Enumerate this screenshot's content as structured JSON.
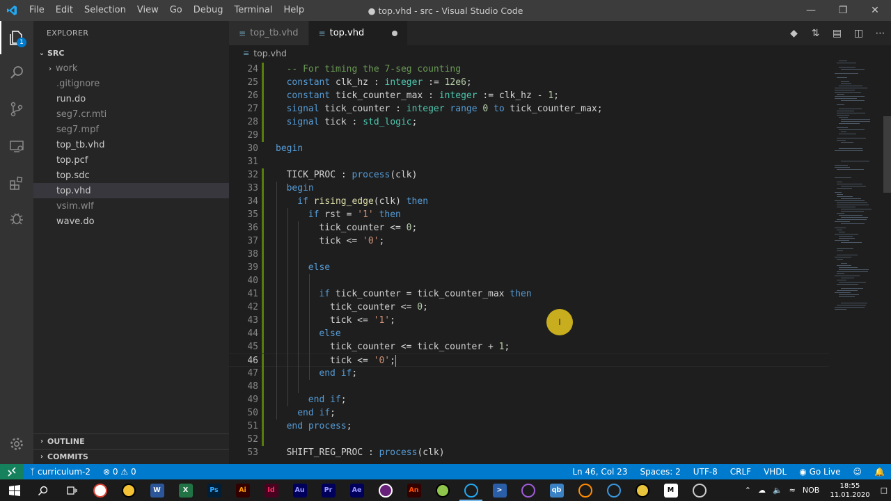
{
  "window": {
    "title": "● top.vhd - src - Visual Studio Code",
    "menu": [
      "File",
      "Edit",
      "Selection",
      "View",
      "Go",
      "Debug",
      "Terminal",
      "Help"
    ]
  },
  "activity_bar": {
    "explorer_badge": "1"
  },
  "sidebar": {
    "title": "EXPLORER",
    "folder": "SRC",
    "items": [
      {
        "label": "work",
        "folder": true,
        "dim": true
      },
      {
        "label": ".gitignore",
        "dim": true
      },
      {
        "label": "run.do"
      },
      {
        "label": "seg7.cr.mti",
        "dim": true
      },
      {
        "label": "seg7.mpf",
        "dim": true
      },
      {
        "label": "top_tb.vhd"
      },
      {
        "label": "top.pcf"
      },
      {
        "label": "top.sdc"
      },
      {
        "label": "top.vhd",
        "selected": true
      },
      {
        "label": "vsim.wlf",
        "dim": true
      },
      {
        "label": "wave.do"
      }
    ],
    "outline": "OUTLINE",
    "commits": "COMMITS"
  },
  "tabs": [
    {
      "label": "top_tb.vhd",
      "active": false
    },
    {
      "label": "top.vhd",
      "active": true,
      "dirty": true
    }
  ],
  "breadcrumb": "top.vhd",
  "editor": {
    "lines": [
      {
        "n": "24",
        "indent": 1,
        "tokens": [
          [
            "cm",
            "-- For timing the 7-seg counting"
          ]
        ]
      },
      {
        "n": "25",
        "indent": 1,
        "tokens": [
          [
            "kw",
            "constant"
          ],
          [
            "id",
            " clk_hz : "
          ],
          [
            "ty",
            "integer"
          ],
          [
            "id",
            " := "
          ],
          [
            "num",
            "12e6"
          ],
          [
            "id",
            ";"
          ]
        ]
      },
      {
        "n": "26",
        "indent": 1,
        "tokens": [
          [
            "kw",
            "constant"
          ],
          [
            "id",
            " tick_counter_max : "
          ],
          [
            "ty",
            "integer"
          ],
          [
            "id",
            " := clk_hz - "
          ],
          [
            "num",
            "1"
          ],
          [
            "id",
            ";"
          ]
        ]
      },
      {
        "n": "27",
        "indent": 1,
        "tokens": [
          [
            "kw",
            "signal"
          ],
          [
            "id",
            " tick_counter : "
          ],
          [
            "ty",
            "integer"
          ],
          [
            "kw",
            " range "
          ],
          [
            "num",
            "0"
          ],
          [
            "kw",
            " to"
          ],
          [
            "id",
            " tick_counter_max;"
          ]
        ]
      },
      {
        "n": "28",
        "indent": 1,
        "tokens": [
          [
            "kw",
            "signal"
          ],
          [
            "id",
            " tick : "
          ],
          [
            "ty",
            "std_logic"
          ],
          [
            "id",
            ";"
          ]
        ]
      },
      {
        "n": "29",
        "indent": 0,
        "tokens": []
      },
      {
        "n": "30",
        "indent": 0,
        "tokens": [
          [
            "kw",
            "begin"
          ]
        ]
      },
      {
        "n": "31",
        "indent": 0,
        "tokens": []
      },
      {
        "n": "32",
        "indent": 1,
        "tokens": [
          [
            "id",
            "TICK_PROC : "
          ],
          [
            "kw",
            "process"
          ],
          [
            "id",
            "(clk)"
          ]
        ]
      },
      {
        "n": "33",
        "indent": 1,
        "tokens": [
          [
            "kw",
            "begin"
          ]
        ]
      },
      {
        "n": "34",
        "indent": 2,
        "tokens": [
          [
            "kw",
            "if"
          ],
          [
            "id",
            " "
          ],
          [
            "fn",
            "rising_edge"
          ],
          [
            "id",
            "(clk) "
          ],
          [
            "kw",
            "then"
          ]
        ]
      },
      {
        "n": "35",
        "indent": 3,
        "tokens": [
          [
            "kw",
            "if"
          ],
          [
            "id",
            " rst = "
          ],
          [
            "str",
            "'1'"
          ],
          [
            "id",
            " "
          ],
          [
            "kw",
            "then"
          ]
        ]
      },
      {
        "n": "36",
        "indent": 4,
        "tokens": [
          [
            "id",
            "tick_counter <= "
          ],
          [
            "num",
            "0"
          ],
          [
            "id",
            ";"
          ]
        ]
      },
      {
        "n": "37",
        "indent": 4,
        "tokens": [
          [
            "id",
            "tick <= "
          ],
          [
            "str",
            "'0'"
          ],
          [
            "id",
            ";"
          ]
        ]
      },
      {
        "n": "38",
        "indent": 0,
        "tokens": []
      },
      {
        "n": "39",
        "indent": 3,
        "tokens": [
          [
            "kw",
            "else"
          ]
        ]
      },
      {
        "n": "40",
        "indent": 0,
        "tokens": []
      },
      {
        "n": "41",
        "indent": 4,
        "tokens": [
          [
            "kw",
            "if"
          ],
          [
            "id",
            " tick_counter = tick_counter_max "
          ],
          [
            "kw",
            "then"
          ]
        ]
      },
      {
        "n": "42",
        "indent": 5,
        "tokens": [
          [
            "id",
            "tick_counter <= "
          ],
          [
            "num",
            "0"
          ],
          [
            "id",
            ";"
          ]
        ]
      },
      {
        "n": "43",
        "indent": 5,
        "tokens": [
          [
            "id",
            "tick <= "
          ],
          [
            "str",
            "'1'"
          ],
          [
            "id",
            ";"
          ]
        ]
      },
      {
        "n": "44",
        "indent": 4,
        "tokens": [
          [
            "kw",
            "else"
          ]
        ]
      },
      {
        "n": "45",
        "indent": 5,
        "tokens": [
          [
            "id",
            "tick_counter <= tick_counter + "
          ],
          [
            "num",
            "1"
          ],
          [
            "id",
            ";"
          ]
        ]
      },
      {
        "n": "46",
        "indent": 5,
        "tokens": [
          [
            "id",
            "tick <= "
          ],
          [
            "str",
            "'0'"
          ],
          [
            "id",
            ";"
          ]
        ],
        "current": true
      },
      {
        "n": "47",
        "indent": 4,
        "tokens": [
          [
            "kw",
            "end if"
          ],
          [
            "id",
            ";"
          ]
        ]
      },
      {
        "n": "48",
        "indent": 0,
        "tokens": []
      },
      {
        "n": "49",
        "indent": 3,
        "tokens": [
          [
            "kw",
            "end if"
          ],
          [
            "id",
            ";"
          ]
        ]
      },
      {
        "n": "50",
        "indent": 2,
        "tokens": [
          [
            "kw",
            "end if"
          ],
          [
            "id",
            ";"
          ]
        ]
      },
      {
        "n": "51",
        "indent": 1,
        "tokens": [
          [
            "kw",
            "end process"
          ],
          [
            "id",
            ";"
          ]
        ]
      },
      {
        "n": "52",
        "indent": 0,
        "tokens": []
      },
      {
        "n": "53",
        "indent": 1,
        "tokens": [
          [
            "id",
            "SHIFT_REG_PROC : "
          ],
          [
            "kw",
            "process"
          ],
          [
            "id",
            "(clk)"
          ]
        ]
      }
    ],
    "modified_lines": [
      "24",
      "25",
      "26",
      "27",
      "28",
      "29",
      "32",
      "33",
      "34",
      "35",
      "36",
      "37",
      "38",
      "39",
      "40",
      "41",
      "42",
      "43",
      "44",
      "45",
      "46",
      "47",
      "48",
      "49",
      "50",
      "51",
      "52"
    ]
  },
  "status_bar": {
    "branch": "curriculum-2",
    "errors": "0",
    "warnings": "0",
    "position": "Ln 46, Col 23",
    "spaces": "Spaces: 2",
    "encoding": "UTF-8",
    "eol": "CRLF",
    "language": "VHDL",
    "golive": "Go Live"
  },
  "taskbar": {
    "apps": [
      {
        "name": "chrome",
        "label": "",
        "bg": "#ffffff",
        "fg": "#db4437"
      },
      {
        "name": "file-explorer",
        "label": "",
        "bg": "#f3c335",
        "fg": "#000"
      },
      {
        "name": "word",
        "label": "W",
        "bg": "#2b579a",
        "fg": "#ffffff"
      },
      {
        "name": "excel",
        "label": "X",
        "bg": "#217346",
        "fg": "#ffffff"
      },
      {
        "name": "photoshop",
        "label": "Ps",
        "bg": "#001e36",
        "fg": "#31a8ff"
      },
      {
        "name": "illustrator",
        "label": "Ai",
        "bg": "#330000",
        "fg": "#ff9a00"
      },
      {
        "name": "indesign",
        "label": "Id",
        "bg": "#49021f",
        "fg": "#ff3366"
      },
      {
        "name": "audition",
        "label": "Au",
        "bg": "#00005b",
        "fg": "#9999ff"
      },
      {
        "name": "premiere",
        "label": "Pr",
        "bg": "#00005b",
        "fg": "#9999ff"
      },
      {
        "name": "after-effects",
        "label": "Ae",
        "bg": "#00005b",
        "fg": "#9999ff"
      },
      {
        "name": "visual-studio",
        "label": "",
        "bg": "#68217a",
        "fg": "#ffffff"
      },
      {
        "name": "animate",
        "label": "An",
        "bg": "#330000",
        "fg": "#ff4f00"
      },
      {
        "name": "notepadpp",
        "label": "",
        "bg": "#90c54b",
        "fg": "#000000"
      },
      {
        "name": "vscode",
        "label": "",
        "bg": "#1b1b1b",
        "fg": "#23a9f2",
        "active": true
      },
      {
        "name": "powershell",
        "label": ">",
        "bg": "#2a5fa8",
        "fg": "#ffffff"
      },
      {
        "name": "app-purple",
        "label": "",
        "bg": "#1b1b1b",
        "fg": "#a05cd8"
      },
      {
        "name": "qbittorrent",
        "label": "qb",
        "bg": "#3b82c4",
        "fg": "#ffffff"
      },
      {
        "name": "app-flag",
        "label": "",
        "bg": "#1b1b1b",
        "fg": "#ff8c00"
      },
      {
        "name": "app-globe",
        "label": "",
        "bg": "#1b1b1b",
        "fg": "#3a96dd"
      },
      {
        "name": "app-yellow",
        "label": "",
        "bg": "#e8c43c",
        "fg": "#000"
      },
      {
        "name": "app-m",
        "label": "M",
        "bg": "#ffffff",
        "fg": "#000000"
      },
      {
        "name": "app-circle",
        "label": "",
        "bg": "#1b1b1b",
        "fg": "#cccccc"
      }
    ],
    "language": "NOB",
    "time": "18:55",
    "date": "11.01.2020"
  }
}
